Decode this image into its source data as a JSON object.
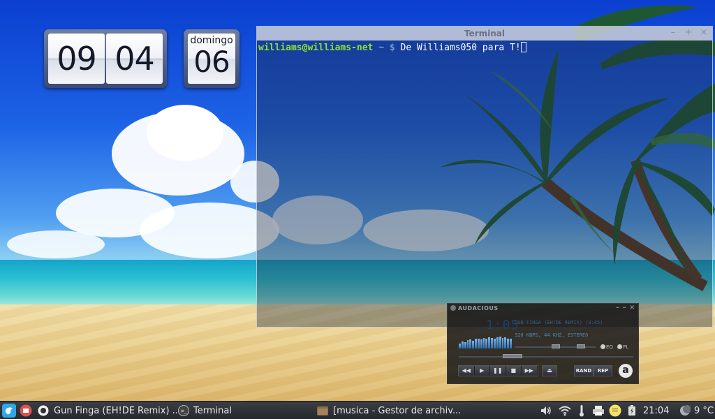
{
  "clock": {
    "hours": "09",
    "minutes": "04",
    "weekday": "domingo",
    "day": "06"
  },
  "terminal": {
    "title": "Terminal",
    "prompt_user": "williams@williams-net",
    "prompt_path": " ~ $ ",
    "command": "De Williams050 para T!"
  },
  "audacious": {
    "title": "AUDACIOUS",
    "time": "1:05",
    "song": "GUN FINGA (EH!DE REMIX) (3:45)",
    "info": "320 KBPS, 44 KHZ, ESTEREO",
    "eq_label": "EQ",
    "pl_label": "PL",
    "rand_label": "RAND",
    "rep_label": "REP",
    "logo": "a",
    "visualizer": [
      0.4,
      0.55,
      0.5,
      0.65,
      0.7,
      0.6,
      0.75,
      0.8,
      0.7,
      0.85,
      0.8,
      0.9,
      0.85,
      0.8,
      0.9,
      0.95,
      0.85,
      0.9,
      0.8,
      0.75
    ]
  },
  "taskbar": {
    "tasks": [
      {
        "label": "Gun Finga (EH!DE Remix) ..."
      },
      {
        "label": "Terminal"
      },
      {
        "label": "[musica - Gestor de archiv..."
      }
    ],
    "time": "21:04",
    "temperature": "9 °C"
  },
  "colors": {
    "prompt_user": "#8ae234",
    "prompt_path": "#729fcf",
    "taskbar_bg": "#2c2f33",
    "menu_icon": "#2ea8e6",
    "red_icon": "#d9534f"
  }
}
